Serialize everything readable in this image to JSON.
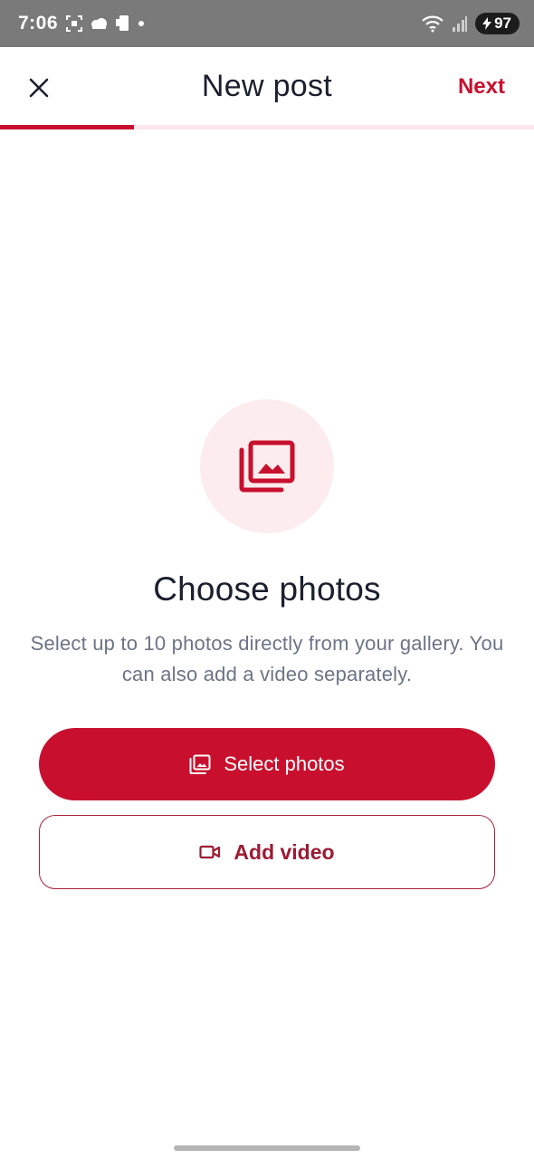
{
  "status_bar": {
    "time": "7:06",
    "battery": "97",
    "icons_left": [
      "screenshot-icon",
      "weather-icon",
      "phone-icon"
    ],
    "icons_right": [
      "wifi-icon",
      "signal-icon",
      "battery-icon"
    ]
  },
  "header": {
    "title": "New post",
    "next_label": "Next",
    "close_icon": "close-icon",
    "progress": 0.25
  },
  "main": {
    "icon": "photo-library-icon",
    "title": "Choose photos",
    "description": "Select up to 10 photos directly from your gallery. You can also add a video separately.",
    "select_photos_label": "Select photos",
    "add_video_label": "Add video"
  },
  "colors": {
    "accent": "#c8102e",
    "accent_light": "#fdecee",
    "text_primary": "#1b1f2e",
    "text_secondary": "#6b7486"
  }
}
